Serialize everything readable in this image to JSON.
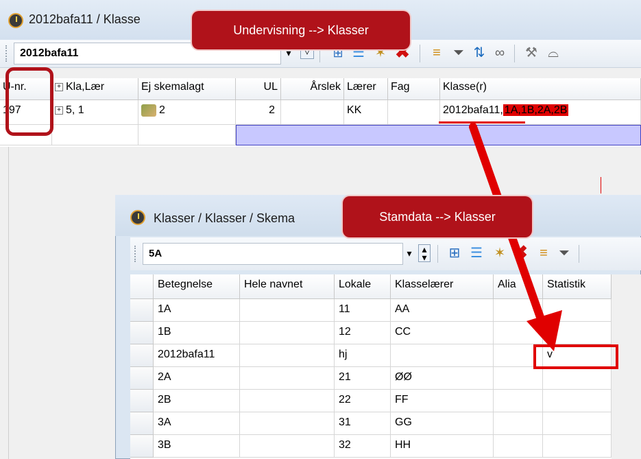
{
  "main_window": {
    "title": "2012bafa11 / Klasse",
    "combo_value": "2012bafa11",
    "columns": [
      "U-nr.",
      "Kla,Lær",
      "Ej skemalagt",
      "UL",
      "Årslek",
      "Lærer",
      "Fag",
      "Klasse(r)"
    ],
    "row": {
      "unr": "197",
      "klalaer": "5, 1",
      "ej": "2",
      "ul": "2",
      "aarslek": "",
      "laerer": "KK",
      "fag": "",
      "klasse_main": "2012bafa11",
      "klasse_sep": ",",
      "klasse_extra": "1A,1B,2A,2B"
    }
  },
  "callouts": {
    "top": "Undervisning --> Klasser",
    "inner": "Stamdata --> Klasser"
  },
  "sub_window": {
    "title": "Klasser / Klasser / Skema",
    "combo_value": "5A",
    "columns": [
      "Betegnelse",
      "Hele navnet",
      "Lokale",
      "Klasselærer",
      "Alia",
      "Statistik"
    ],
    "rows": [
      {
        "betegnelse": "1A",
        "hele": "",
        "lokale": "11",
        "klasselaerer": "AA",
        "alias": "",
        "statistik": ""
      },
      {
        "betegnelse": "1B",
        "hele": "",
        "lokale": "12",
        "klasselaerer": "CC",
        "alias": "",
        "statistik": ""
      },
      {
        "betegnelse": "2012bafa11",
        "hele": "",
        "lokale": "hj",
        "klasselaerer": "",
        "alias": "",
        "statistik": "v"
      },
      {
        "betegnelse": "2A",
        "hele": "",
        "lokale": "21",
        "klasselaerer": "ØØ",
        "alias": "",
        "statistik": ""
      },
      {
        "betegnelse": "2B",
        "hele": "",
        "lokale": "22",
        "klasselaerer": "FF",
        "alias": "",
        "statistik": ""
      },
      {
        "betegnelse": "3A",
        "hele": "",
        "lokale": "31",
        "klasselaerer": "GG",
        "alias": "",
        "statistik": ""
      },
      {
        "betegnelse": "3B",
        "hele": "",
        "lokale": "32",
        "klasselaerer": "HH",
        "alias": "",
        "statistik": ""
      }
    ]
  },
  "colors": {
    "callout": "#b0121a",
    "highlight": "#e00000",
    "selection_row": "#c8c8ff"
  },
  "icons": {
    "clock": "untis-clock-icon",
    "dropdown": "chevron-down-icon",
    "delete": "red-x-delete-icon",
    "filter": "filter-icon",
    "link": "link-icon"
  }
}
